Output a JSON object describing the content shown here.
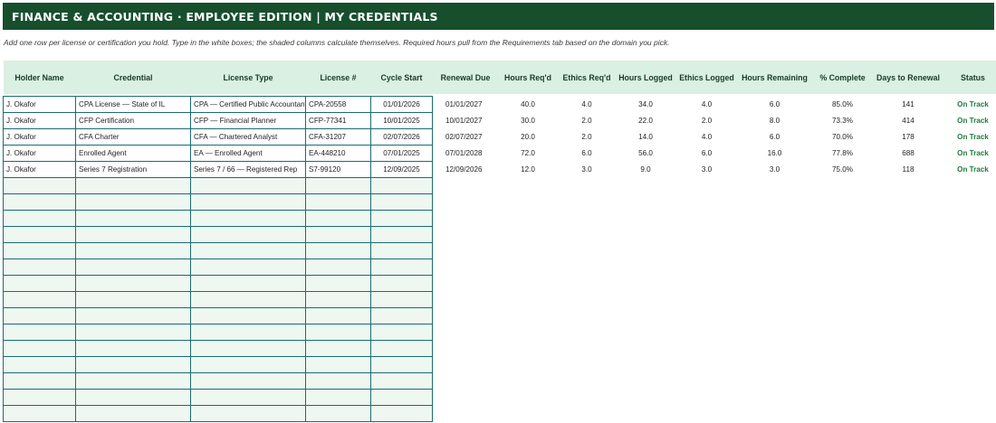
{
  "header": {
    "title": "FINANCE & ACCOUNTING  ·  EMPLOYEE EDITION  |  MY CREDENTIALS"
  },
  "instructions": "Add one row per license or certification you hold. Type in the white boxes; the shaded columns calculate themselves. Required hours pull from the Requirements tab based on the domain you pick.",
  "columns": [
    "Holder Name",
    "Credential",
    "License Type",
    "License #",
    "Cycle Start",
    "Renewal Due",
    "Hours Req'd",
    "Ethics Req'd",
    "Hours Logged",
    "Ethics Logged",
    "Hours Remaining",
    "% Complete",
    "Days to Renewal",
    "Status"
  ],
  "rows": [
    {
      "holder": "J. Okafor",
      "credential": "CPA License — State of IL",
      "license_type": "CPA — Certified Public Accountant",
      "license_no": "CPA-20558",
      "cycle_start": "01/01/2026",
      "renewal_due": "01/01/2027",
      "hours_req": "40.0",
      "ethics_req": "4.0",
      "hours_logged": "34.0",
      "ethics_logged": "4.0",
      "hours_remaining": "6.0",
      "pct_complete": "85.0%",
      "days_to_renewal": "141",
      "status": "On Track"
    },
    {
      "holder": "J. Okafor",
      "credential": "CFP Certification",
      "license_type": "CFP — Financial Planner",
      "license_no": "CFP-77341",
      "cycle_start": "10/01/2025",
      "renewal_due": "10/01/2027",
      "hours_req": "30.0",
      "ethics_req": "2.0",
      "hours_logged": "22.0",
      "ethics_logged": "2.0",
      "hours_remaining": "8.0",
      "pct_complete": "73.3%",
      "days_to_renewal": "414",
      "status": "On Track"
    },
    {
      "holder": "J. Okafor",
      "credential": "CFA Charter",
      "license_type": "CFA — Chartered Analyst",
      "license_no": "CFA-31207",
      "cycle_start": "02/07/2026",
      "renewal_due": "02/07/2027",
      "hours_req": "20.0",
      "ethics_req": "2.0",
      "hours_logged": "14.0",
      "ethics_logged": "4.0",
      "hours_remaining": "6.0",
      "pct_complete": "70.0%",
      "days_to_renewal": "178",
      "status": "On Track"
    },
    {
      "holder": "J. Okafor",
      "credential": "Enrolled Agent",
      "license_type": "EA — Enrolled Agent",
      "license_no": "EA-448210",
      "cycle_start": "07/01/2025",
      "renewal_due": "07/01/2028",
      "hours_req": "72.0",
      "ethics_req": "6.0",
      "hours_logged": "56.0",
      "ethics_logged": "6.0",
      "hours_remaining": "16.0",
      "pct_complete": "77.8%",
      "days_to_renewal": "688",
      "status": "On Track"
    },
    {
      "holder": "J. Okafor",
      "credential": "Series 7 Registration",
      "license_type": "Series 7 / 66 — Registered Rep",
      "license_no": "S7-99120",
      "cycle_start": "12/09/2025",
      "renewal_due": "12/09/2026",
      "hours_req": "12.0",
      "ethics_req": "3.0",
      "hours_logged": "9.0",
      "ethics_logged": "3.0",
      "hours_remaining": "3.0",
      "pct_complete": "75.0%",
      "days_to_renewal": "118",
      "status": "On Track"
    }
  ],
  "colors": {
    "title_bg": "#174f2d",
    "header_bg": "#daf0e2",
    "input_border": "#1b6c73",
    "empty_input_bg": "#eef8f1",
    "status_on_track": "#1e7a3e"
  }
}
